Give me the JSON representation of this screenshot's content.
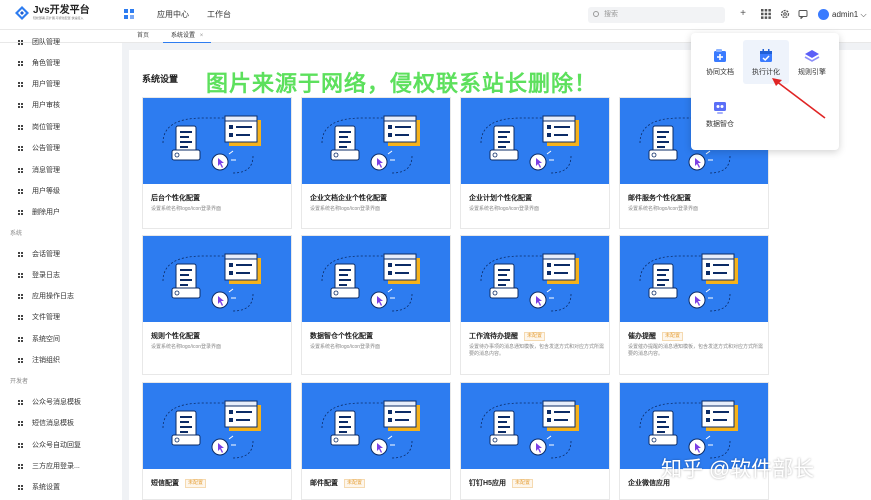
{
  "app": {
    "logo_title": "Jvs开发平台",
    "logo_subtitle": "轻松部署,高扩展,可视化配置,快速接入",
    "top_nav": [
      "应用中心",
      "工作台"
    ],
    "search_placeholder": "搜索",
    "username": "admin1",
    "accent_color": "#2d7cf0"
  },
  "tabs": [
    {
      "label": "首页"
    },
    {
      "label": "系统设置",
      "close": "×"
    }
  ],
  "sidebar": {
    "items_a": [
      "团队管理",
      "角色管理",
      "用户管理",
      "用户审核",
      "岗位管理",
      "公告管理",
      "消息管理",
      "用户等级",
      "删除用户"
    ],
    "group_system": "系统",
    "items_b": [
      "会话管理",
      "登录日志",
      "应用操作日志",
      "文件管理",
      "系统空间",
      "注销组织"
    ],
    "group_dev": "开发者",
    "items_c": [
      "公众号消息模板",
      "短信消息模板",
      "公众号自动回复",
      "三方应用登录...",
      "系统设置"
    ]
  },
  "main": {
    "title": "系统设置",
    "watermark": "图片来源于网络，侵权联系站长删除！",
    "cards": [
      {
        "title": "后台个性化配置",
        "badge": "",
        "desc": "设置系统名称logo/icon登录界面"
      },
      {
        "title": "企业文档企业个性化配置",
        "badge": "",
        "desc": "设置系统名称logo/icon登录界面"
      },
      {
        "title": "企业计划个性化配置",
        "badge": "",
        "desc": "设置系统名称logo/icon登录界面"
      },
      {
        "title": "邮件服务个性化配置",
        "badge": "",
        "desc": "设置系统名称logo/icon登录界面"
      },
      {
        "title": "规则个性化配置",
        "badge": "",
        "desc": "设置系统名称logo/icon登录界面"
      },
      {
        "title": "数据智仓个性化配置",
        "badge": "",
        "desc": "设置系统名称logo/icon登录界面"
      },
      {
        "title": "工作流待办提醒",
        "badge": "未配置",
        "desc": "设置待办事项的消息通知模板，包含发送方式和对应方式所需要的消息内容。"
      },
      {
        "title": "催办提醒",
        "badge": "未配置",
        "desc": "设置催办提醒的消息通知模板，包含发送方式和对应方式所需要的消息内容。"
      },
      {
        "title": "短信配置",
        "badge": "未配置",
        "desc": ""
      },
      {
        "title": "邮件配置",
        "badge": "未配置",
        "desc": ""
      },
      {
        "title": "钉钉H5应用",
        "badge": "未配置",
        "desc": ""
      },
      {
        "title": "企业微信应用",
        "badge": "",
        "desc": ""
      }
    ]
  },
  "popup": {
    "items": [
      {
        "label": "协同文档",
        "icon": "doc-plus-icon",
        "color": "#3a7bff"
      },
      {
        "label": "执行计化",
        "icon": "calendar-check-icon",
        "color": "#3a7bff"
      },
      {
        "label": "规则引擎",
        "icon": "layers-icon",
        "color": "#5b5ef7"
      },
      {
        "label": "数据智仓",
        "icon": "data-warehouse-icon",
        "color": "#5b6ff7"
      }
    ]
  },
  "watermark_source": "知乎 @软件部长"
}
